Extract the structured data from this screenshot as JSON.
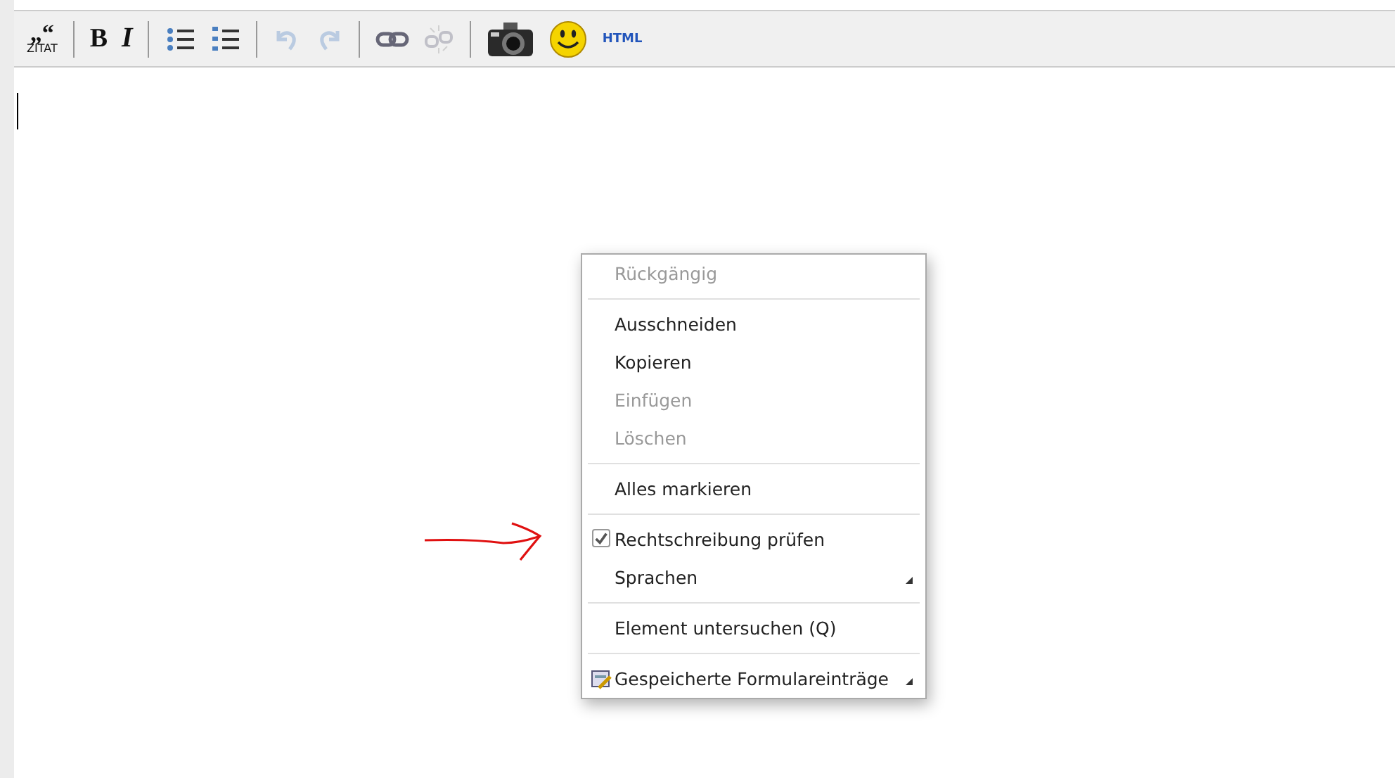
{
  "toolbar": {
    "items": [
      {
        "kind": "quote",
        "marks": "„“",
        "label": "ZITAT",
        "disabled": false
      },
      {
        "kind": "separator"
      },
      {
        "kind": "bold",
        "label": "B",
        "disabled": false
      },
      {
        "kind": "italic",
        "label": "I",
        "disabled": false
      },
      {
        "kind": "separator"
      },
      {
        "kind": "bullet-list",
        "disabled": false
      },
      {
        "kind": "numbered-list",
        "disabled": false
      },
      {
        "kind": "separator"
      },
      {
        "kind": "undo",
        "disabled": true
      },
      {
        "kind": "redo",
        "disabled": true
      },
      {
        "kind": "separator"
      },
      {
        "kind": "link",
        "disabled": false
      },
      {
        "kind": "unlink",
        "disabled": true
      },
      {
        "kind": "separator"
      },
      {
        "kind": "camera",
        "disabled": false
      },
      {
        "kind": "smiley",
        "disabled": false
      },
      {
        "kind": "html",
        "label": "HTML",
        "disabled": false
      }
    ]
  },
  "context_menu": {
    "items": [
      {
        "kind": "item",
        "label": "Rückgängig",
        "disabled": true
      },
      {
        "kind": "separator"
      },
      {
        "kind": "item",
        "label": "Ausschneiden",
        "disabled": false
      },
      {
        "kind": "item",
        "label": "Kopieren",
        "disabled": false
      },
      {
        "kind": "item",
        "label": "Einfügen",
        "disabled": true
      },
      {
        "kind": "item",
        "label": "Löschen",
        "disabled": true
      },
      {
        "kind": "separator"
      },
      {
        "kind": "item",
        "label": "Alles markieren",
        "disabled": false
      },
      {
        "kind": "separator"
      },
      {
        "kind": "check",
        "label": "Rechtschreibung prüfen",
        "disabled": false,
        "checked": true
      },
      {
        "kind": "submenu",
        "label": "Sprachen",
        "disabled": false
      },
      {
        "kind": "separator"
      },
      {
        "kind": "item",
        "label": "Element untersuchen (Q)",
        "disabled": false
      },
      {
        "kind": "separator"
      },
      {
        "kind": "icon-submenu",
        "label": "Gespeicherte Formulareinträge",
        "disabled": false
      }
    ]
  }
}
